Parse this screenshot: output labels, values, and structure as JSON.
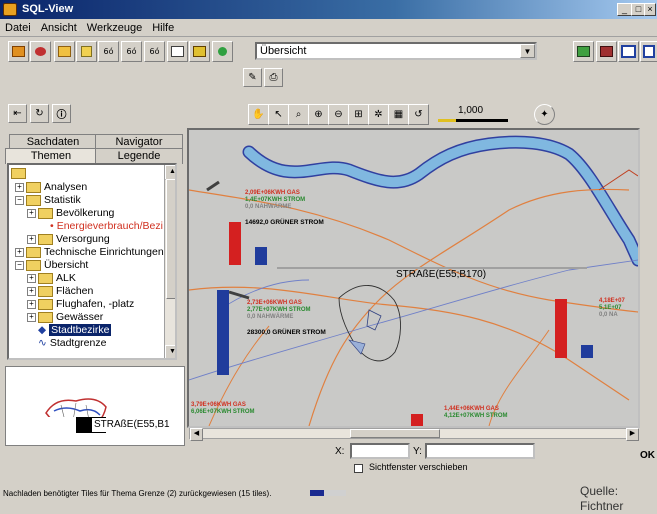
{
  "window": {
    "title": "SQL-View",
    "minimize": "_",
    "maximize": "□",
    "close": "×"
  },
  "menu": [
    "Datei",
    "Ansicht",
    "Werkzeuge",
    "Hilfe"
  ],
  "toolbar": {
    "buttons": [
      "open-folder",
      "layers",
      "folder",
      "search",
      "binoculars-1",
      "binoculars-2",
      "binoculars-3",
      "table",
      "window",
      "globe"
    ],
    "view_select_value": "Übersicht",
    "zoom_scale": "1,000"
  },
  "left_panel": {
    "tabs_row1": [
      "Sachdaten",
      "Navigator"
    ],
    "tabs_row2": [
      "Themen",
      "Legende"
    ],
    "active_tab": "Themen",
    "tree": [
      {
        "label": "Analysen",
        "level": 1,
        "expander": "+"
      },
      {
        "label": "Statistik",
        "level": 1,
        "expander": "−"
      },
      {
        "label": "Bevölkerung",
        "level": 2,
        "expander": "+"
      },
      {
        "label": "Energieverbrauch/Bezi",
        "level": 3,
        "expander": "",
        "color": "#d03020"
      },
      {
        "label": "Versorgung",
        "level": 2,
        "expander": "+"
      },
      {
        "label": "Technische Einrichtungen",
        "level": 1,
        "expander": "+"
      },
      {
        "label": "Übersicht",
        "level": 1,
        "expander": "−"
      },
      {
        "label": "ALK",
        "level": 2,
        "expander": "+"
      },
      {
        "label": "Flächen",
        "level": 2,
        "expander": "+"
      },
      {
        "label": "Flughafen, -platz",
        "level": 2,
        "expander": "+"
      },
      {
        "label": "Gewässer",
        "level": 2,
        "expander": "+"
      },
      {
        "label": "Stadtbezirke",
        "level": 2,
        "expander": "",
        "selected": true
      },
      {
        "label": "Stadtgrenze",
        "level": 2,
        "expander": ""
      }
    ]
  },
  "overview": {
    "label": "STRAßE(E55,B1"
  },
  "map": {
    "road_label": "STRAßE(E55;B170)",
    "bar_colors": {
      "red": "#d42020",
      "blue": "#203c9c"
    },
    "bar_groups": [
      {
        "red": 0.62,
        "blue": 0.26,
        "annotations": [
          "2,09E+06KWH GAS",
          "1,4E+07KWH STROM",
          "0,0 NAHWÄRME",
          "14692,0 GRÜNER STROM"
        ]
      },
      {
        "red": 0.0,
        "blue": 0.95,
        "annotations": [
          "2,73E+06KWH GAS",
          "2,77E+07KWH STROM",
          "0,0 NAHWÄRME",
          "28300,0 GRÜNER STROM"
        ]
      },
      {
        "red": 0.74,
        "blue": 0.16,
        "annotations": [
          "4,18E+07",
          "5,1E+07",
          "0,0 NA"
        ]
      },
      {
        "red": 0.0,
        "blue": 0.0,
        "annotations": [
          "3,79E+06KWH GAS",
          "6,06E+07KWH STROM"
        ]
      },
      {
        "red": 0.3,
        "blue": 0.0,
        "annotations": [
          "1,44E+06KWH GAS",
          "4,12E+07KWH STROM"
        ]
      }
    ]
  },
  "coords": {
    "x_label": "X:",
    "y_label": "Y:",
    "x_value": "",
    "y_value": ""
  },
  "checkbox": {
    "label": "Sichtfenster verschieben",
    "checked": false
  },
  "ok_label": "OK",
  "status": {
    "text": "Nachladen benötigter Tiles für Thema Grenze (2) zurückgewiesen (15 tiles).",
    "progress": 0.4
  },
  "source": "Quelle: Fichtner"
}
